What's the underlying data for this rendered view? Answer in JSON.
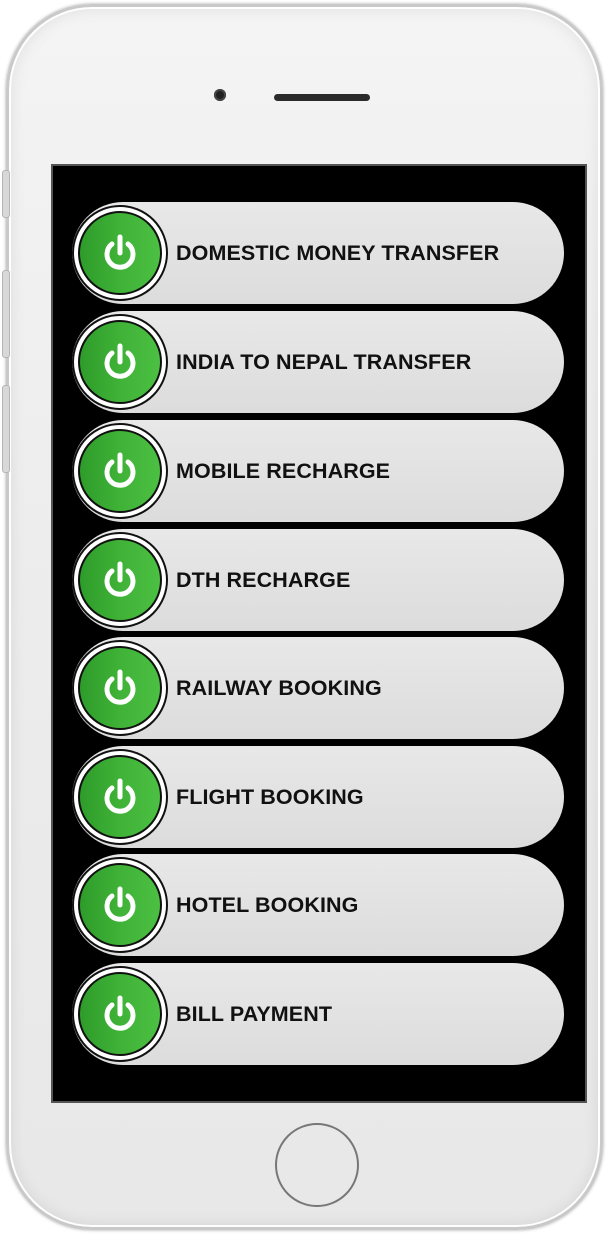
{
  "app": {
    "accent_color": "#3fb237",
    "menu": [
      {
        "label": "DOMESTIC MONEY TRANSFER",
        "icon": "power-icon"
      },
      {
        "label": "INDIA TO NEPAL TRANSFER",
        "icon": "power-icon"
      },
      {
        "label": "MOBILE RECHARGE",
        "icon": "power-icon"
      },
      {
        "label": "DTH RECHARGE",
        "icon": "power-icon"
      },
      {
        "label": "RAILWAY BOOKING",
        "icon": "power-icon"
      },
      {
        "label": "FLIGHT BOOKING",
        "icon": "power-icon"
      },
      {
        "label": "HOTEL BOOKING",
        "icon": "power-icon"
      },
      {
        "label": "BILL PAYMENT",
        "icon": "power-icon"
      }
    ]
  }
}
